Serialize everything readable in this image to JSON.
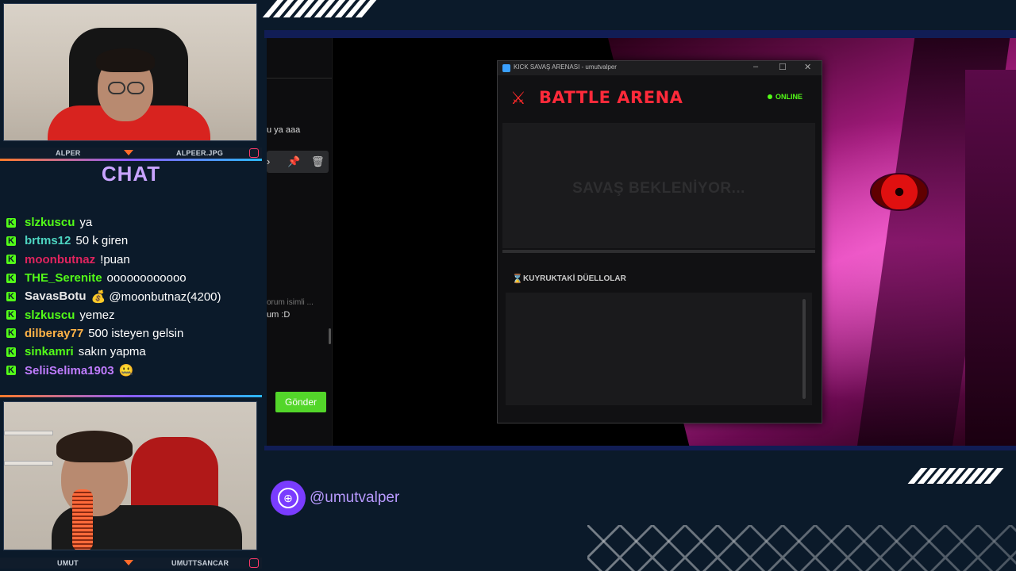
{
  "colors": {
    "kick_green": "#53fc18",
    "chat_title": "#c9a4ff",
    "arena_red": "#ff2a3a",
    "handle_purple": "#b89aff",
    "gonder_green": "#53d62a"
  },
  "cams": {
    "top": {
      "left_name": "ALPER",
      "right_name": "ALPEER.JPG"
    },
    "bottom": {
      "left_name": "UMUT",
      "right_name": "UMUTTSANCAR"
    }
  },
  "chat": {
    "title": "CHAT",
    "badge_icon": "kick-icon",
    "messages": [
      {
        "user": "slzkuscu",
        "color": "#53fc18",
        "text": "ya"
      },
      {
        "user": "brtms12",
        "color": "#4dd4c0",
        "text": "50 k giren"
      },
      {
        "user": "moonbutnaz",
        "color": "#e0245e",
        "text": "!puan"
      },
      {
        "user": "THE_Serenite",
        "color": "#53fc18",
        "text": "oooooooooooo"
      },
      {
        "user": "SavasBotu",
        "color": "#e8e8e8",
        "text": "💰 @moonbutnaz(4200)"
      },
      {
        "user": "slzkuscu",
        "color": "#53fc18",
        "text": "yemez"
      },
      {
        "user": "dilberay77",
        "color": "#ffb347",
        "text": "500 isteyen gelsin"
      },
      {
        "user": "sinkamri",
        "color": "#53fc18",
        "text": "sakın yapma"
      },
      {
        "user": "SeliiSelima1903",
        "color": "#c07cff",
        "text": "🤐"
      }
    ]
  },
  "bg_app": {
    "snippet1": "u ya aaa",
    "snippet2": "orum isimli ...",
    "snippet3": "um :D",
    "send_label": "Gönder"
  },
  "arena_window": {
    "title": "KICK SAVAŞ ARENASI - umutvalper",
    "heading": "BATTLE ARENA",
    "status": "ONLINE",
    "waiting_text": "SAVAŞ BEKLENİYOR...",
    "queue_title": "KUYRUKTAKİ DÜELLOLAR",
    "controls": {
      "minimize": "–",
      "maximize": "☐",
      "close": "✕"
    }
  },
  "social": {
    "handle": "@umutvalper",
    "icon": "globe-icon"
  }
}
